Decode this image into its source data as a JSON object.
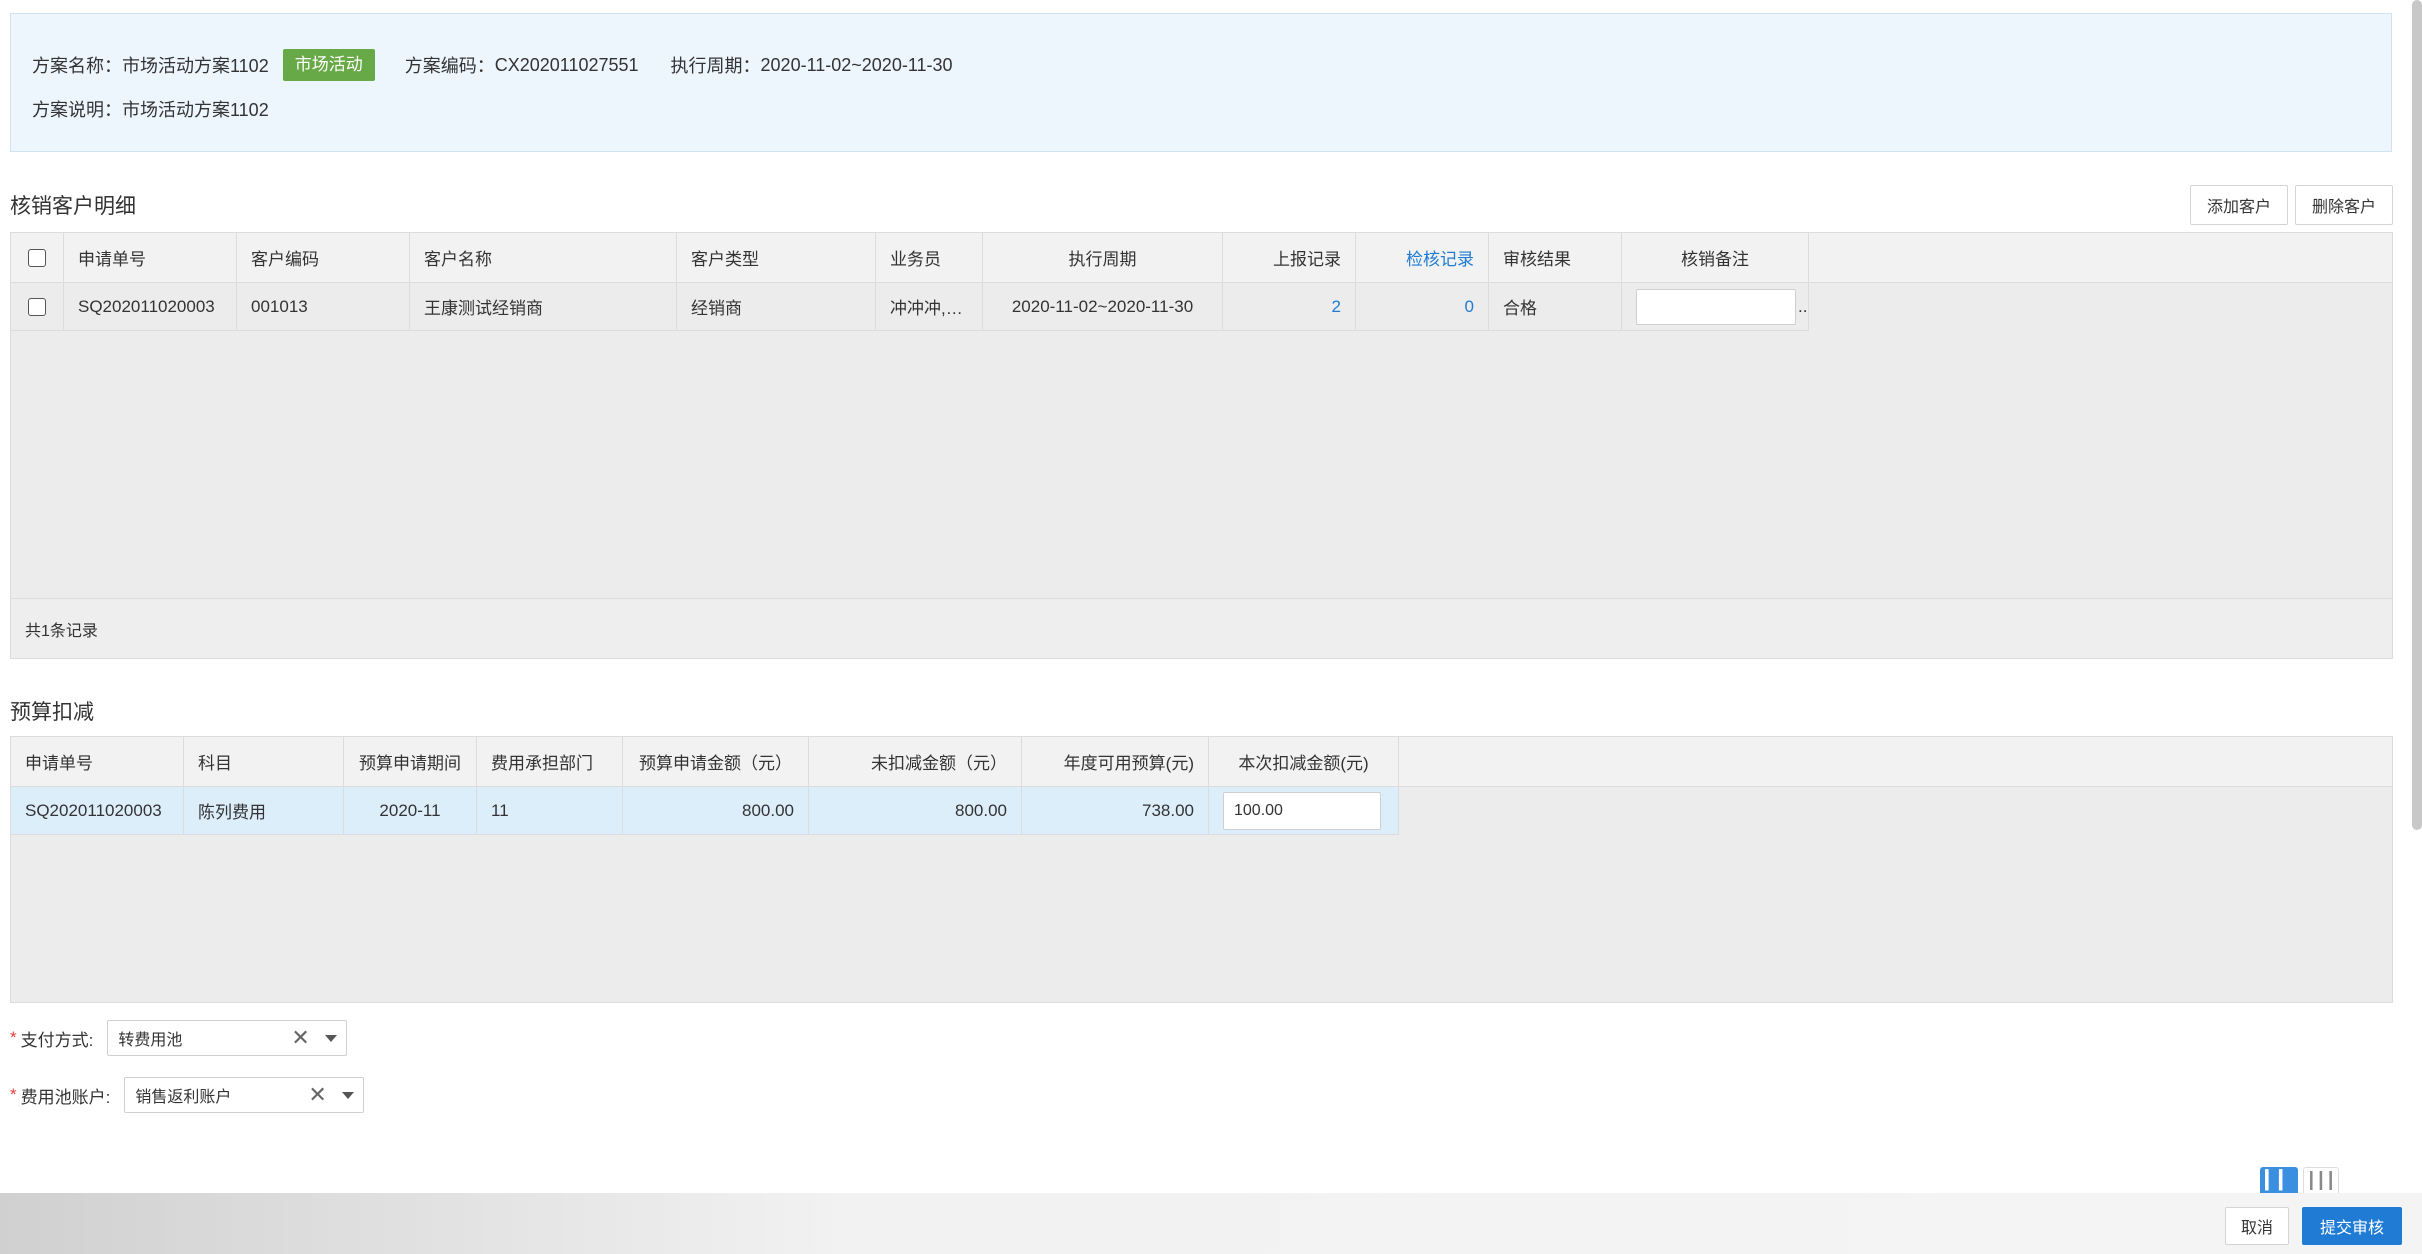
{
  "info": {
    "name_label": "方案名称：",
    "name_value": "市场活动方案1102",
    "tag": "市场活动",
    "code_label": "方案编码：",
    "code_value": "CX202011027551",
    "period_label": "执行周期：",
    "period_value": "2020-11-02~2020-11-30",
    "desc_label": "方案说明：",
    "desc_value": "市场活动方案1102"
  },
  "customers": {
    "title": "核销客户明细",
    "add_button": "添加客户",
    "delete_button": "删除客户",
    "columns": [
      "申请单号",
      "客户编码",
      "客户名称",
      "客户类型",
      "业务员",
      "执行周期",
      "上报记录",
      "检核记录",
      "审核结果",
      "核销备注"
    ],
    "rows": [
      {
        "apply_no": "SQ202011020003",
        "customer_code": "001013",
        "customer_name": "王康测试经销商",
        "customer_type": "经销商",
        "salesman": "冲冲冲,…",
        "period": "2020-11-02~2020-11-30",
        "report_count": "2",
        "check_count": "0",
        "audit_result": "合格",
        "remark": "",
        "remark_more": ".."
      }
    ],
    "footer": "共1条记录"
  },
  "budget": {
    "title": "预算扣减",
    "columns": [
      "申请单号",
      "科目",
      "预算申请期间",
      "费用承担部门",
      "预算申请金额（元）",
      "未扣减金额（元）",
      "年度可用预算(元)",
      "本次扣减金额(元)"
    ],
    "rows": [
      {
        "apply_no": "SQ202011020003",
        "subject": "陈列费用",
        "period": "2020-11",
        "dept": "11",
        "apply_amount": "800.00",
        "remaining": "800.00",
        "available": "738.00",
        "deduct": "100.00"
      }
    ]
  },
  "form": {
    "payment_label": "支付方式:",
    "payment_value": "转费用池",
    "pool_label": "费用池账户:",
    "pool_value": "销售返利账户",
    "required_mark": "*"
  },
  "actions": {
    "cancel": "取消",
    "submit": "提交审核"
  },
  "colors": {
    "accent": "#1f7bd3",
    "tag_green": "#67a946",
    "info_bg": "#eef6fd",
    "selected_row": "#ddeefb",
    "required": "#e23c3c"
  }
}
